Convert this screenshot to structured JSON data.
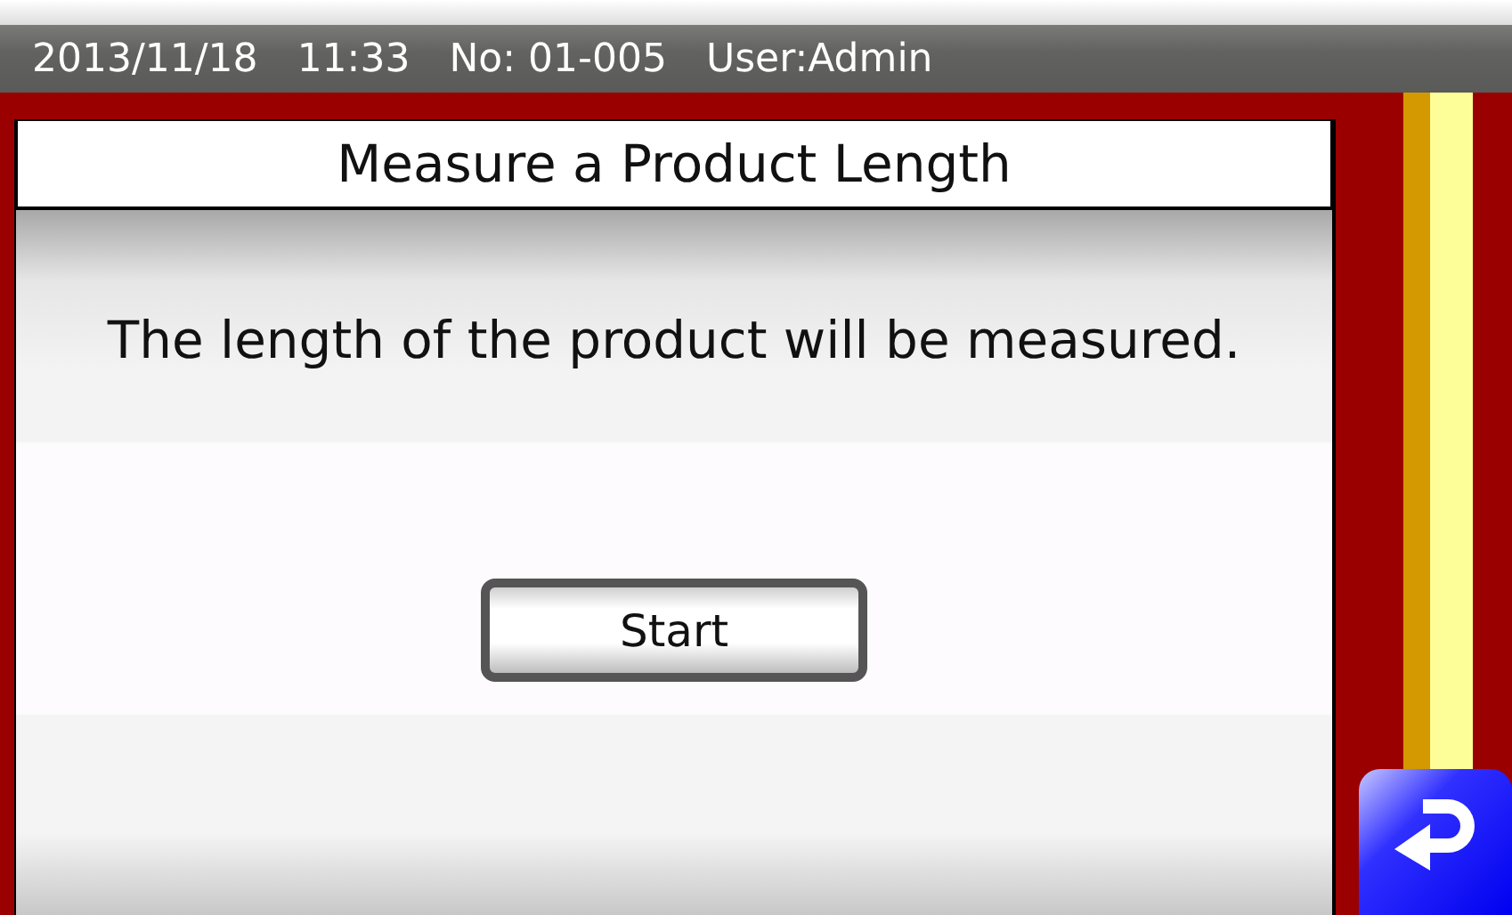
{
  "status_bar": {
    "date": "2013/11/18",
    "time": "11:33",
    "number": "No: 01-005",
    "user": "User:Admin"
  },
  "panel": {
    "title": "Measure a Product Length",
    "message": "The length of the product will be measured."
  },
  "buttons": [
    {
      "kind": "start",
      "label": "Start"
    },
    {
      "kind": "back"
    }
  ]
}
